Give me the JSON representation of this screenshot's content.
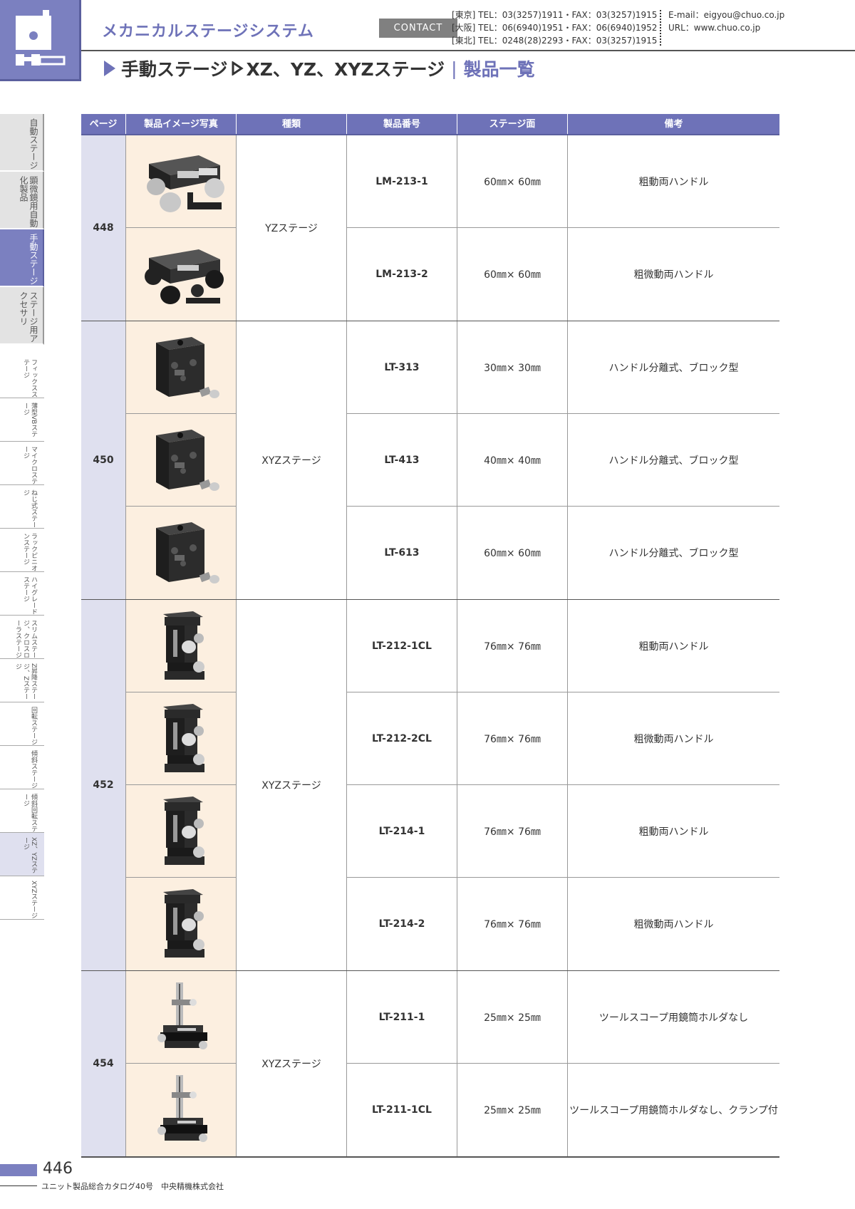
{
  "header": {
    "series_title": "メカニカルステージシステム",
    "contact_label": "CONTACT",
    "tel_lines": [
      "[東京] TEL：03(3257)1911・FAX：03(3257)1915",
      "[大阪] TEL：06(6940)1951・FAX：06(6940)1952",
      "[東北] TEL：0248(28)2293・FAX：03(3257)1915"
    ],
    "email": "E-mail：eigyou@chuo.co.jp",
    "url": "URL：www.chuo.co.jp",
    "title_part1": "手動ステージ",
    "title_part2": "XZ、YZ、XYZステージ",
    "title_sep": "|",
    "title_part3": "製品一覧"
  },
  "side_tabs": [
    {
      "label": "自動ステージ",
      "active": false
    },
    {
      "label": "顕微鏡用自動化製品",
      "active": false
    },
    {
      "label": "手動ステージ",
      "active": true
    },
    {
      "label": "ステージ用アクセサリ",
      "active": false
    }
  ],
  "sub_tabs": [
    {
      "label": "フィックスステージ",
      "active": false
    },
    {
      "label": "薄型VBステージ",
      "active": false
    },
    {
      "label": "マイクロステージ",
      "active": false
    },
    {
      "label": "ねじ式ステージ",
      "active": false
    },
    {
      "label": "ラックピニオンステージ",
      "active": false
    },
    {
      "label": "ハイグレードステージ",
      "active": false
    },
    {
      "label": "スリムステージ、クロスローラステージ",
      "active": false
    },
    {
      "label": "Z昇降ステージ、Zステージ",
      "active": false
    },
    {
      "label": "回転ステージ",
      "active": false
    },
    {
      "label": "傾斜ステージ",
      "active": false
    },
    {
      "label": "傾斜回転ステージ",
      "active": false
    },
    {
      "label": "XZ、YZステージ",
      "active": true
    },
    {
      "label": "XYZステージ",
      "active": false
    }
  ],
  "table": {
    "headers": [
      "ページ",
      "製品イメージ写真",
      "種類",
      "製品番号",
      "ステージ面",
      "備考"
    ],
    "groups": [
      {
        "page": "448",
        "type": "YZステージ",
        "rows": [
          {
            "num": "LM-213-1",
            "face": "60㎜× 60㎜",
            "note": "粗動両ハンドル",
            "img": "yz-coarse"
          },
          {
            "num": "LM-213-2",
            "face": "60㎜× 60㎜",
            "note": "粗微動両ハンドル",
            "img": "yz-fine"
          }
        ]
      },
      {
        "page": "450",
        "type": "XYZステージ",
        "rows": [
          {
            "num": "LT-313",
            "face": "30㎜× 30㎜",
            "note": "ハンドル分離式、ブロック型",
            "img": "block"
          },
          {
            "num": "LT-413",
            "face": "40㎜× 40㎜",
            "note": "ハンドル分離式、ブロック型",
            "img": "block"
          },
          {
            "num": "LT-613",
            "face": "60㎜× 60㎜",
            "note": "ハンドル分離式、ブロック型",
            "img": "block"
          }
        ]
      },
      {
        "page": "452",
        "type": "XYZステージ",
        "rows": [
          {
            "num": "LT-212-1CL",
            "face": "76㎜× 76㎜",
            "note": "粗動両ハンドル",
            "img": "tower"
          },
          {
            "num": "LT-212-2CL",
            "face": "76㎜× 76㎜",
            "note": "粗微動両ハンドル",
            "img": "tower"
          },
          {
            "num": "LT-214-1",
            "face": "76㎜× 76㎜",
            "note": "粗動両ハンドル",
            "img": "tower"
          },
          {
            "num": "LT-214-2",
            "face": "76㎜× 76㎜",
            "note": "粗微動両ハンドル",
            "img": "tower"
          }
        ]
      },
      {
        "page": "454",
        "type": "XYZステージ",
        "rows": [
          {
            "num": "LT-211-1",
            "face": "25㎜× 25㎜",
            "note": "ツールスコープ用鏡筒ホルダなし",
            "img": "scope"
          },
          {
            "num": "LT-211-1CL",
            "face": "25㎜× 25㎜",
            "note": "ツールスコープ用鏡筒ホルダなし、クランプ付",
            "img": "scope"
          }
        ]
      }
    ]
  },
  "footer": {
    "page_number": "446",
    "catalog": "ユニット製品総合カタログ40号　中央精機株式会社"
  }
}
